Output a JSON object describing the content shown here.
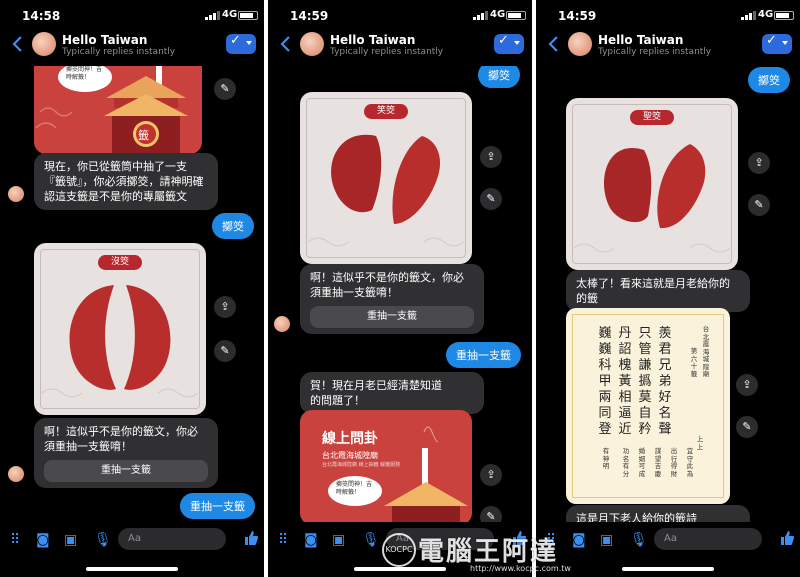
{
  "app": {
    "contact_name": "Hello Taiwan",
    "contact_status": "Typically replies instantly",
    "network": "4G",
    "accent": "#1e88e5",
    "composer_placeholder": "Aa"
  },
  "panels": [
    {
      "time": "14:58",
      "messages": {
        "text1": "現在，你已從籤筒中抽了一支『籤號』，你必須擲筊，請神明確認這支籤是不是你的專屬籤文",
        "sent1": "擲筊",
        "card_label": "沒筊",
        "text2": "啊！這似乎不是你的籤文，你必須重抽一支籤唷！",
        "redo": "重抽一支籤",
        "sent2": "重抽一支籤",
        "sign_char": "籤",
        "speech": "擲筊問神！吉時解籤！"
      }
    },
    {
      "time": "14:59",
      "messages": {
        "sent0": "擲筊",
        "card_label": "笑筊",
        "text1": "啊！這似乎不是你的籤文，你必須重抽一支籤唷！",
        "redo": "重抽一支籤",
        "sent1": "重抽一支籤",
        "text2_a": "賀！現在月老已經清楚知道",
        "text2_b": "的問題了！",
        "poster_title": "線上問卦",
        "poster_sub": "台北霞海城隍廟",
        "poster_note": "台北霞海城隍廟 線上抽籤 解籤服務",
        "speech": "擲筊問神！吉時解籤！"
      }
    },
    {
      "time": "14:59",
      "messages": {
        "sent0": "擲筊",
        "card_label": "聖筊",
        "text1": "太棒了！看來這就是月老給你的的籤",
        "poem_cols": [
          "羨君兄弟好名聲",
          "只管謙撝莫自矜",
          "丹詔槐黃相逼近",
          "巍巍科甲兩同登"
        ],
        "poem_temple": "台北霞海城隍廟",
        "poem_number": "第六十籤",
        "poem_grade": "上上",
        "poem_notes": [
          "宜守此為",
          "出行得財",
          "謀望吉慶",
          "婚姻可成",
          "功名有分",
          "有神明"
        ],
        "text2": "這是月下老人給你的籤詩"
      }
    }
  ],
  "watermark": {
    "text": "電腦王阿達",
    "url": "http://www.kocpc.com.tw",
    "logo": "KOCPC"
  }
}
